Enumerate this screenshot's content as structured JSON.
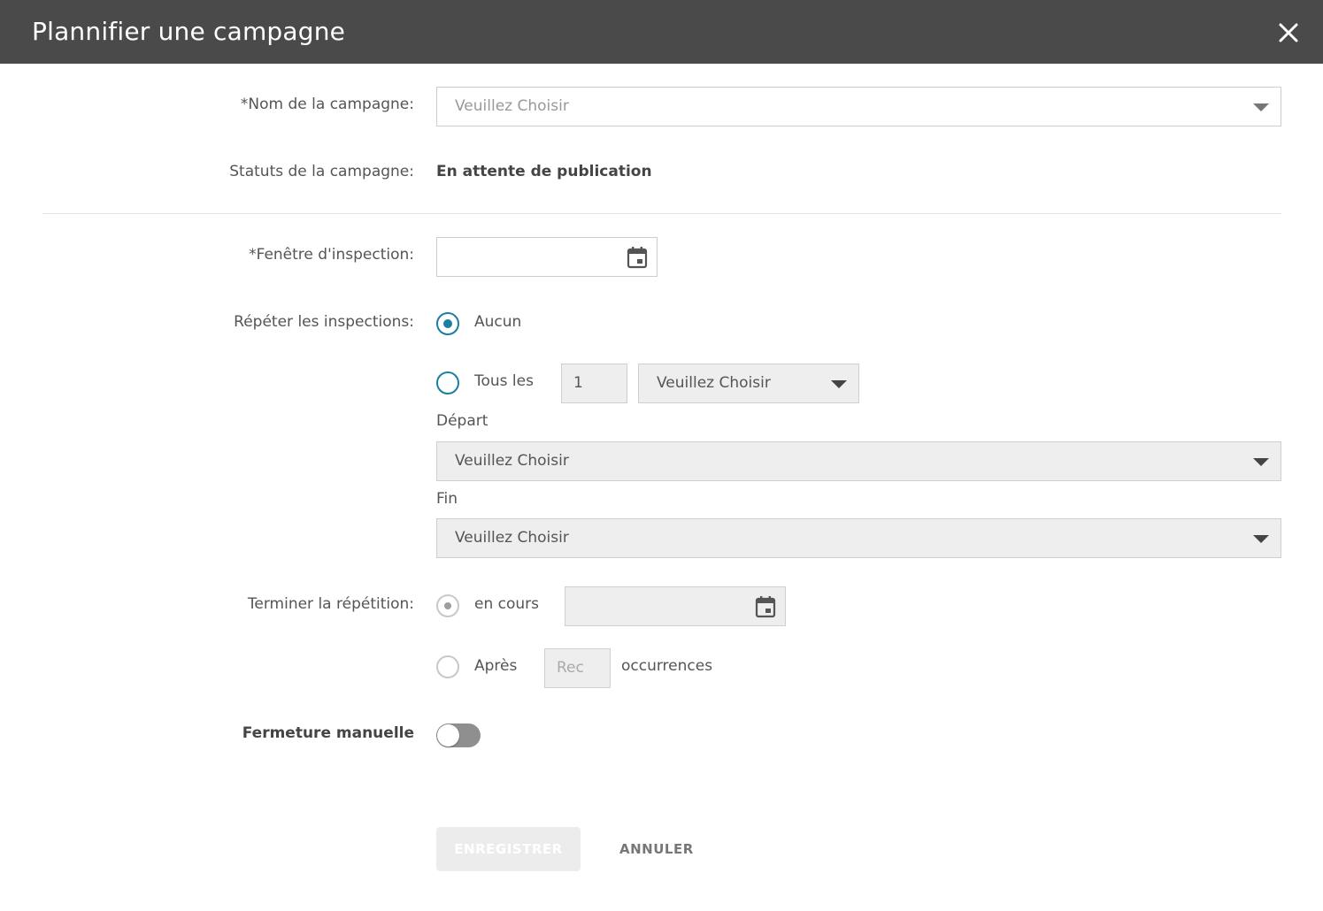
{
  "dialog": {
    "title": "Plannifier une campagne"
  },
  "form": {
    "campaign_name": {
      "label": "*Nom de la campagne:",
      "value": "Veuillez Choisir"
    },
    "campaign_status": {
      "label": "Statuts de la campagne:",
      "value": "En attente de publication"
    },
    "inspection_window": {
      "label": "*Fenêtre d'inspection:",
      "value": ""
    },
    "repeat": {
      "label": "Répéter les inspections:",
      "option_none": "Aucun",
      "option_every": "Tous les",
      "every_count": "1",
      "every_unit": "Veuillez Choisir",
      "selected": "none"
    },
    "start": {
      "label": "Départ",
      "value": "Veuillez Choisir"
    },
    "end": {
      "label": "Fin",
      "value": "Veuillez Choisir"
    },
    "end_repeat": {
      "label": "Terminer la répétition:",
      "option_ongoing": "en cours",
      "option_after": "Après",
      "after_placeholder": "Rec",
      "after_suffix": "occurrences",
      "selected": "ongoing"
    },
    "manual_close": {
      "label": "Fermeture manuelle",
      "enabled": false
    }
  },
  "actions": {
    "save": "ENREGISTRER",
    "cancel": "ANNULER"
  },
  "colors": {
    "header_bg": "#4a4a4a",
    "accent": "#1a7fa0",
    "disabled_bg": "#eeeeee"
  }
}
